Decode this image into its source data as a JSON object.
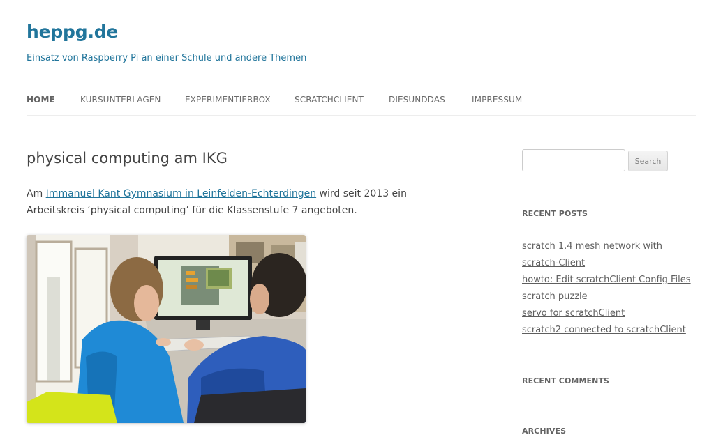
{
  "site": {
    "title": "heppg.de",
    "description": "Einsatz von Raspberry Pi an einer Schule und andere Themen"
  },
  "nav": {
    "items": [
      {
        "label": "HOME",
        "active": true
      },
      {
        "label": "KURSUNTERLAGEN",
        "active": false
      },
      {
        "label": "EXPERIMENTIERBOX",
        "active": false
      },
      {
        "label": "SCRATCHCLIENT",
        "active": false
      },
      {
        "label": "DIESUNDDAS",
        "active": false
      },
      {
        "label": "IMPRESSUM",
        "active": false
      }
    ]
  },
  "entry": {
    "title": "physical computing am IKG",
    "text_prefix": "Am ",
    "link_text": "Immanuel Kant Gymnasium in Leinfelden-Echterdingen",
    "text_suffix": " wird seit 2013 ein Arbeitskreis ‘physical computing’ für die Klassenstufe 7 angeboten."
  },
  "sidebar": {
    "search": {
      "placeholder": "",
      "button_label": "Search"
    },
    "recent_posts": {
      "title": "RECENT POSTS",
      "items": [
        "scratch 1.4 mesh network with scratch-Client",
        "howto: Edit scratchClient Config Files",
        "scratch puzzle",
        "servo for scratchClient",
        "scratch2 connected to scratchClient"
      ]
    },
    "recent_comments": {
      "title": "RECENT COMMENTS"
    },
    "archives": {
      "title": "ARCHIVES"
    }
  },
  "colors": {
    "link": "#21759b",
    "text": "#444444",
    "nav_border": "#ededed"
  }
}
